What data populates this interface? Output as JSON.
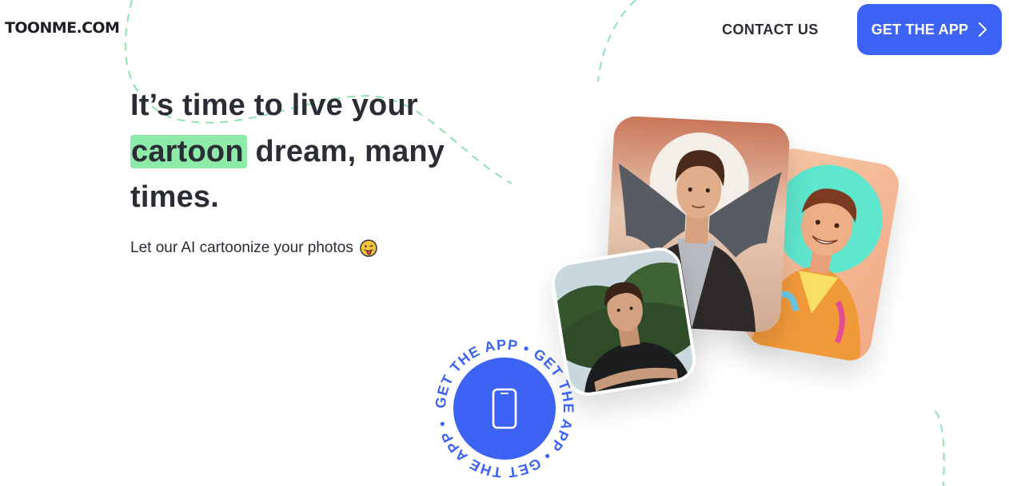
{
  "header": {
    "logo": "TOONME.COM",
    "contact_label": "CONTACT US",
    "cta_label": "GET THE APP"
  },
  "hero": {
    "title_line1": "It’s time to live your",
    "title_highlight": "cartoon",
    "title_line2_rest": " dream, many",
    "title_line3": "times.",
    "subtitle": "Let our AI cartoonize your photos"
  },
  "badge": {
    "ring_text": "GET THE APP • GET THE APP • GET THE APP • ",
    "icon": "phone-icon"
  },
  "icons": {
    "cta_arrow": "chevron-right-icon",
    "emoji": "tongue-out-emoji"
  },
  "colors": {
    "accent": "#3d63f5",
    "highlight": "#8eeaa9",
    "dash_line": "#8ee3b0",
    "text": "#2a2d34"
  }
}
